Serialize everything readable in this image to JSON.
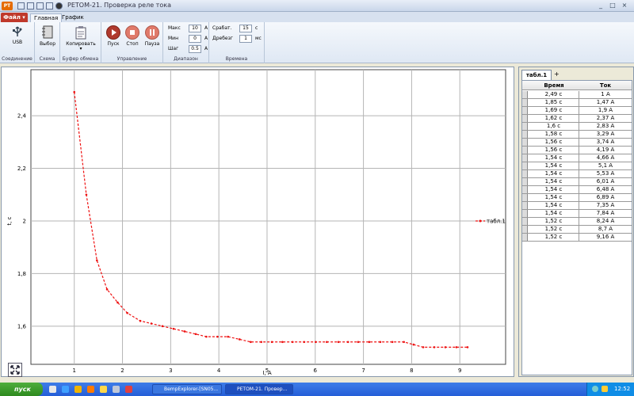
{
  "title_bar": {
    "app_icon": "РТ",
    "title": "РЕТОМ-21. Проверка реле тока",
    "window_buttons": [
      "_",
      "□",
      "×"
    ]
  },
  "ribbon_tabs": {
    "file": "Файл ▾",
    "home": "Главная",
    "graph": "График"
  },
  "ribbon": {
    "connection": {
      "usb_label": "USB",
      "group_label": "Соединение"
    },
    "scheme": {
      "select_label": "Выбор",
      "group_label": "Схема"
    },
    "clipboard": {
      "copy_label": "Копировать",
      "group_label": "Буфер обмена"
    },
    "control": {
      "start_label": "Пуск",
      "stop_label": "Стоп",
      "pause_label": "Пауза",
      "group_label": "Управление"
    },
    "range": {
      "max_label": "Макс",
      "max_value": "10",
      "min_label": "Мин",
      "min_value": "0",
      "step_label": "Шаг",
      "step_value": "0.5",
      "unit": "А",
      "group_label": "Диапазон"
    },
    "times": {
      "trip_label": "Срабат.",
      "trip_value": "15",
      "trip_unit": "с",
      "bounce_label": "Дребезг",
      "bounce_value": "1",
      "bounce_unit": "мс",
      "group_label": "Времена"
    }
  },
  "chart_data": {
    "type": "line",
    "xlabel": "I, A",
    "ylabel": "t, c",
    "xlim": [
      0.1,
      9.95
    ],
    "ylim": [
      1.455,
      2.575
    ],
    "x_ticks": [
      1,
      2,
      3,
      4,
      5,
      6,
      7,
      8,
      9
    ],
    "y_ticks": [
      1.6,
      1.8,
      2,
      2.2,
      2.4
    ],
    "y_tick_labels": [
      "1,6",
      "1,8",
      "2",
      "2,2",
      "2,4"
    ],
    "grid": true,
    "legend": "right",
    "series": [
      {
        "name": "табл.1",
        "color": "#ee1111",
        "x": [
          1.0,
          1.25,
          1.47,
          1.68,
          1.9,
          2.1,
          2.37,
          2.6,
          2.83,
          3.06,
          3.29,
          3.52,
          3.74,
          3.97,
          4.19,
          4.43,
          4.66,
          4.88,
          5.1,
          5.32,
          5.53,
          5.77,
          6.01,
          6.24,
          6.48,
          6.68,
          6.89,
          7.12,
          7.35,
          7.6,
          7.84,
          8.04,
          8.24,
          8.47,
          8.7,
          8.93,
          9.16
        ],
        "y": [
          2.49,
          2.1,
          1.85,
          1.74,
          1.69,
          1.65,
          1.62,
          1.61,
          1.6,
          1.59,
          1.58,
          1.57,
          1.56,
          1.56,
          1.56,
          1.55,
          1.54,
          1.54,
          1.54,
          1.54,
          1.54,
          1.54,
          1.54,
          1.54,
          1.54,
          1.54,
          1.54,
          1.54,
          1.54,
          1.54,
          1.54,
          1.53,
          1.52,
          1.52,
          1.52,
          1.52,
          1.52
        ]
      }
    ]
  },
  "table": {
    "tab_label": "табл.1",
    "add_tab_label": "+",
    "columns": [
      "Время",
      "Ток"
    ],
    "rows": [
      [
        "2,49 с",
        "1 А"
      ],
      [
        "1,85 с",
        "1,47 А"
      ],
      [
        "1,69 с",
        "1,9 А"
      ],
      [
        "1,62 с",
        "2,37 А"
      ],
      [
        "1,6 с",
        "2,83 А"
      ],
      [
        "1,58 с",
        "3,29 А"
      ],
      [
        "1,56 с",
        "3,74 А"
      ],
      [
        "1,56 с",
        "4,19 А"
      ],
      [
        "1,54 с",
        "4,66 А"
      ],
      [
        "1,54 с",
        "5,1 А"
      ],
      [
        "1,54 с",
        "5,53 А"
      ],
      [
        "1,54 с",
        "6,01 А"
      ],
      [
        "1,54 с",
        "6,48 А"
      ],
      [
        "1,54 с",
        "6,89 А"
      ],
      [
        "1,54 с",
        "7,35 А"
      ],
      [
        "1,54 с",
        "7,84 А"
      ],
      [
        "1,52 с",
        "8,24 А"
      ],
      [
        "1,52 с",
        "8,7 А"
      ],
      [
        "1,52 с",
        "9,16 А"
      ]
    ]
  },
  "taskbar": {
    "start_label": "пуск",
    "tasks": [
      "BempExplorer-[SN05...",
      "РЕТОМ-21. Провер..."
    ],
    "clock": "12:52"
  }
}
